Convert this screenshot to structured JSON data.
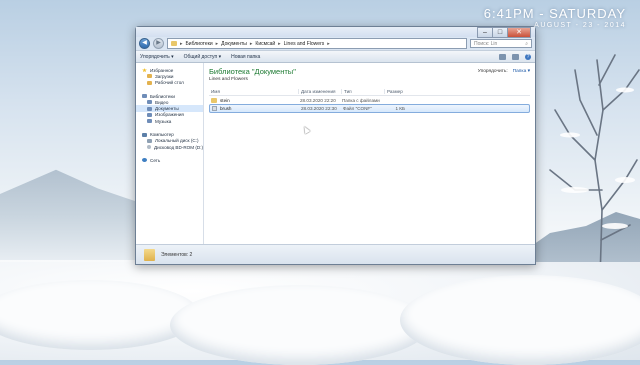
{
  "desktop": {
    "clock_time": "6:41PM - SATURDAY",
    "clock_date": "AUGUST - 23 - 2014"
  },
  "window": {
    "controls": {
      "minimize": "–",
      "maximize": "□",
      "close": "✕"
    },
    "nav": {
      "back": "◀",
      "forward": "▶"
    },
    "breadcrumb": [
      "Библиотеки",
      "Документы",
      "Кисмсай",
      "Lines and Flowers"
    ],
    "search_placeholder": "Поиск: Lin",
    "toolbar": {
      "organize": "Упорядочить ▾",
      "share": "Общий доступ ▾",
      "new_folder": "Новая папка"
    },
    "sidebar": {
      "favorites": {
        "head": "Избранное",
        "items": [
          "Загрузки",
          "Рабочий стол"
        ]
      },
      "libraries": {
        "head": "Библиотеки",
        "items": [
          "Видео",
          "Документы",
          "Изображения",
          "Музыка"
        ]
      },
      "computer": {
        "head": "Компьютер",
        "items": [
          "Локальный диск (C:)",
          "Дисковод BD-ROM (D:)"
        ]
      },
      "network": {
        "head": "Сеть"
      }
    },
    "library": {
      "title": "Библиотека \"Документы\"",
      "subtitle": "Lines and Flowers",
      "arrange_label": "Упорядочить:",
      "arrange_value": "Папка ▾"
    },
    "columns": {
      "name": "Имя",
      "date": "Дата изменения",
      "type": "Тип",
      "size": "Размер"
    },
    "files": [
      {
        "name": "stein",
        "date": "28.03.2020 22:20",
        "type": "Папка с файлами",
        "size": ""
      },
      {
        "name": "brush",
        "date": "28.03.2020 22:30",
        "type": "Файл \"CONF\"",
        "size": "1 КБ"
      }
    ],
    "status": {
      "count": "Элементов: 2"
    }
  }
}
